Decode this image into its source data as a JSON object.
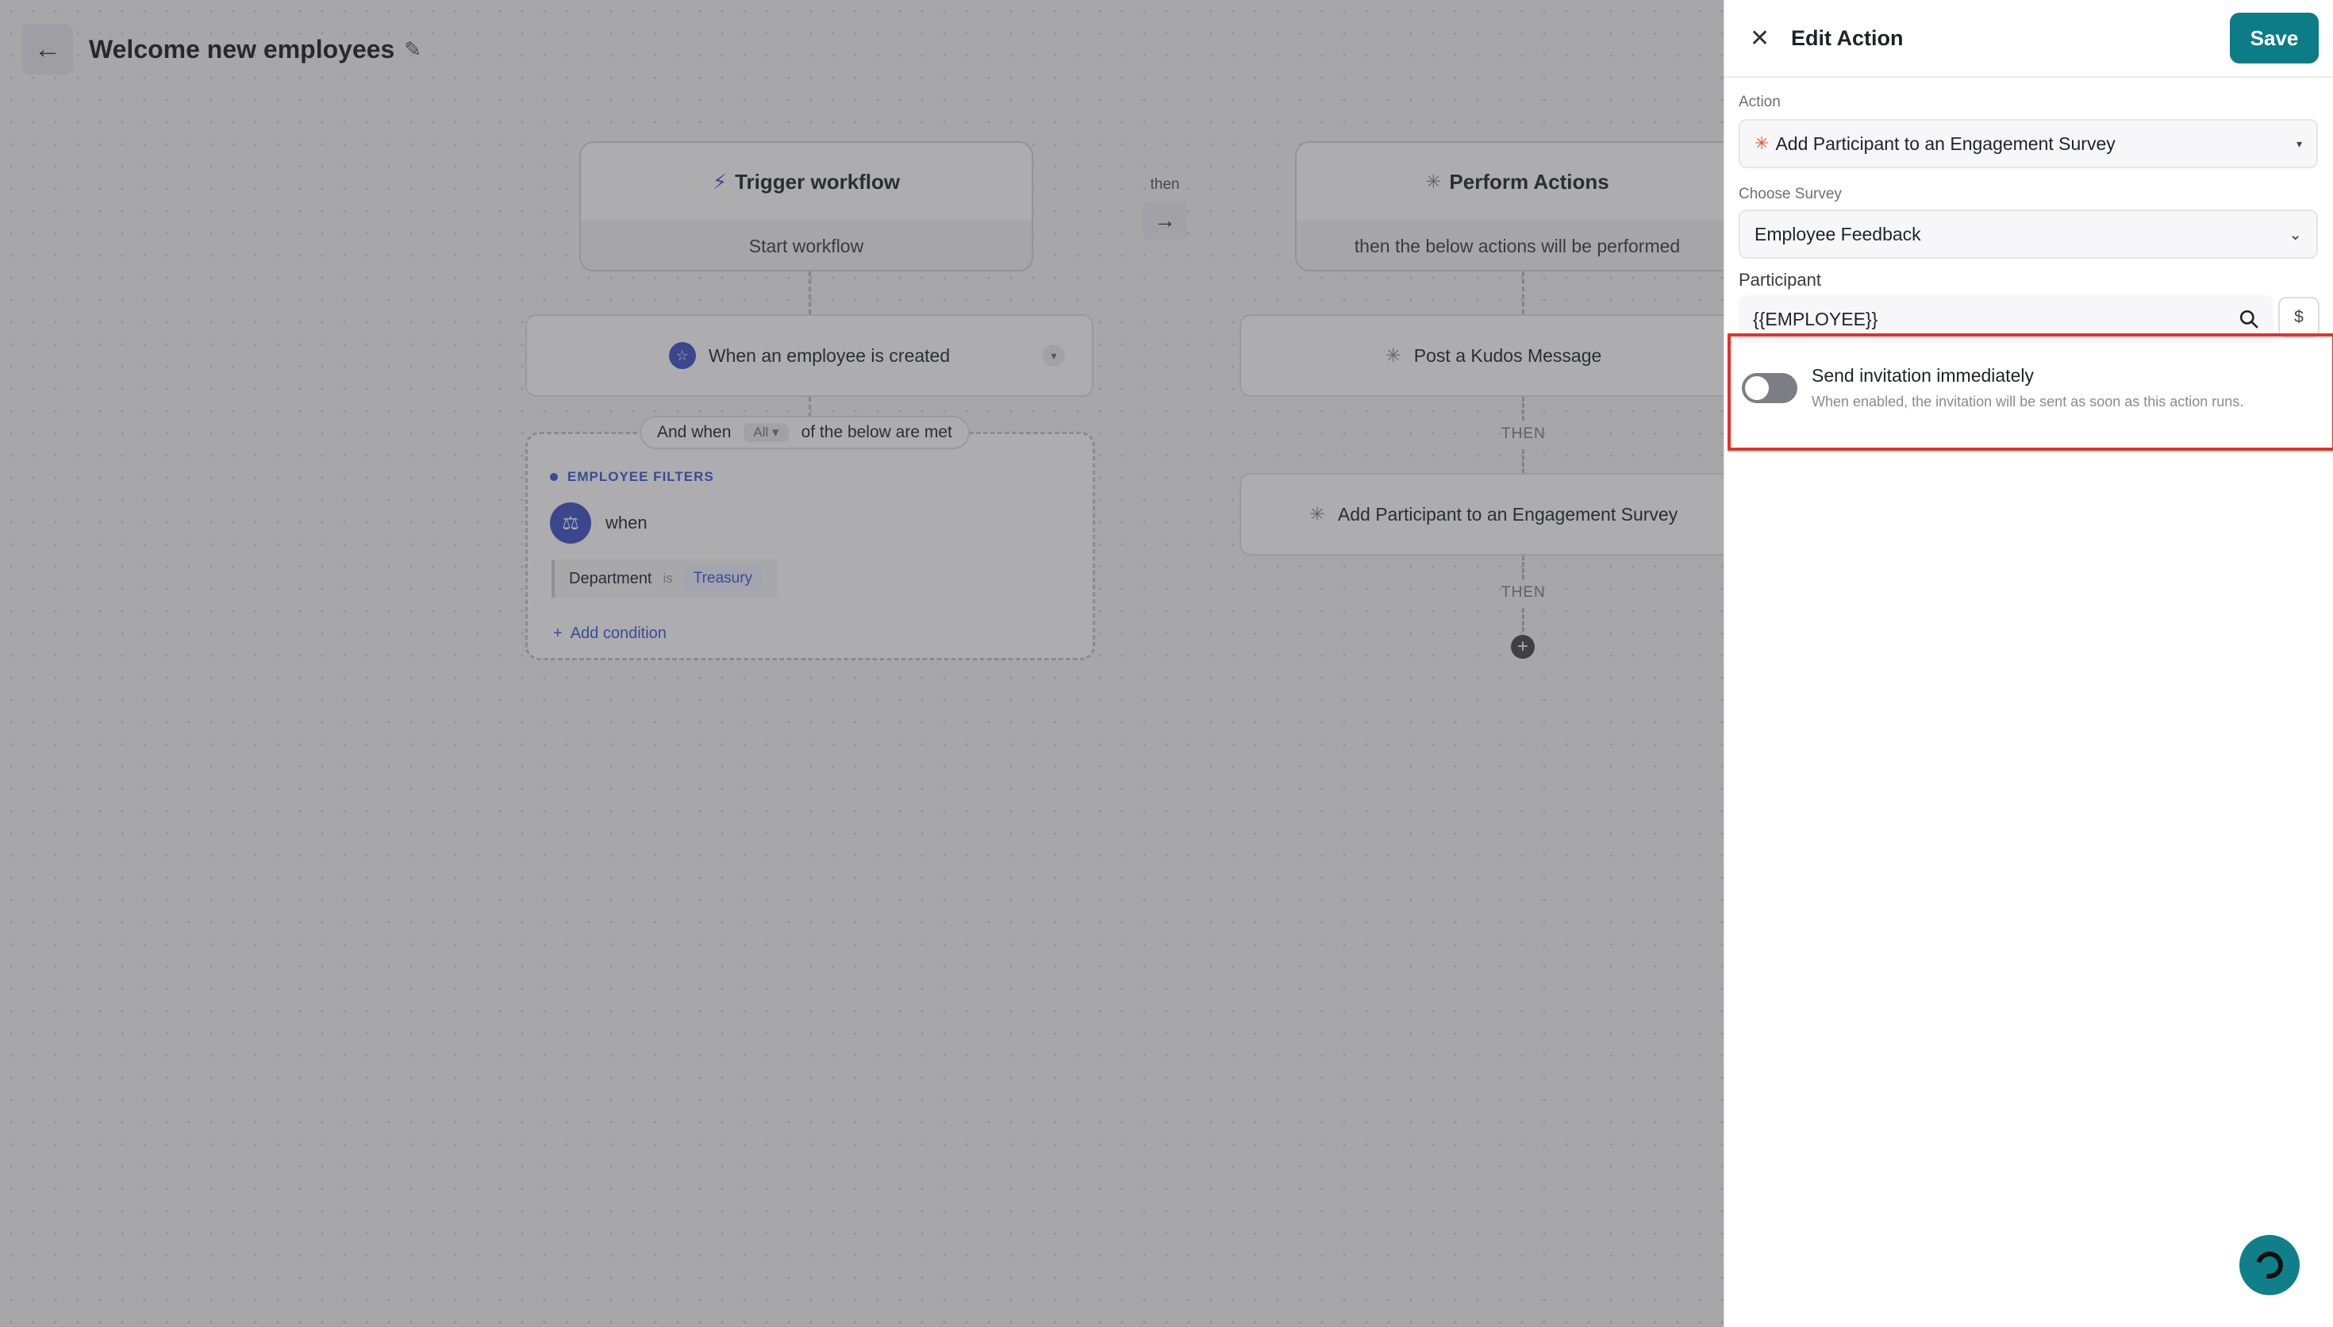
{
  "workflow": {
    "title": "Welcome new employees",
    "back_icon": "arrow-left-icon",
    "edit_icon": "pencil-icon"
  },
  "trigger_card": {
    "title": "Trigger workflow",
    "subtitle": "Start workflow"
  },
  "connector": {
    "label": "then"
  },
  "actions_card": {
    "title": "Perform Actions",
    "subtitle": "then the below actions will be performed"
  },
  "trigger_step": {
    "label": "When an employee is created"
  },
  "conditions": {
    "prefix": "And when",
    "mode": "All",
    "suffix": "of the below are met",
    "filters_title": "EMPLOYEE FILTERS",
    "when_label": "when",
    "condition": {
      "field": "Department",
      "operator": "is",
      "value": "Treasury"
    },
    "add_condition": "Add condition"
  },
  "action_steps": [
    {
      "label": "Post a Kudos Message"
    },
    {
      "label": "Add Participant to an Engagement Survey"
    }
  ],
  "then_separator": "THEN",
  "panel": {
    "title": "Edit Action",
    "save_label": "Save",
    "action_label": "Action",
    "action_value": "Add Participant to an Engagement Survey",
    "survey_label": "Choose Survey",
    "survey_value": "Employee Feedback",
    "participant_label": "Participant",
    "participant_value": "{{EMPLOYEE}}",
    "variable_button": "$",
    "toggle": {
      "title": "Send invitation immediately",
      "description": "When enabled, the invitation will be sent as soon as this action runs.",
      "enabled": false
    }
  },
  "colors": {
    "accent": "#0c7c86",
    "filter_blue": "#3a55d6",
    "highlight_red": "#e4322a"
  }
}
